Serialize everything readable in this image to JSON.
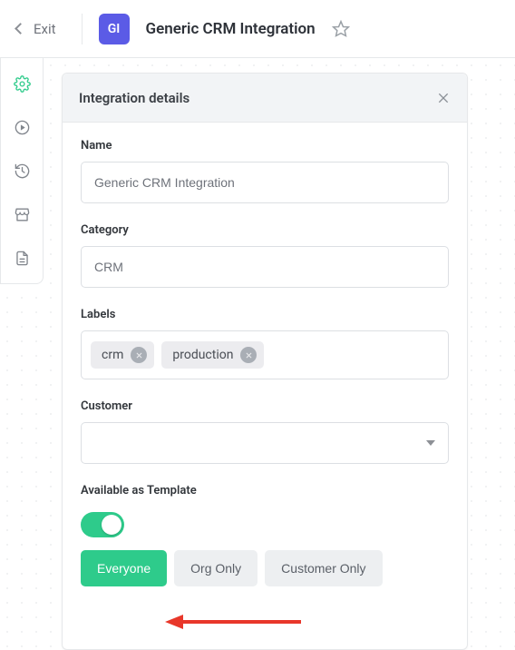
{
  "header": {
    "exit_label": "Exit",
    "badge_text": "GI",
    "title": "Generic CRM Integration"
  },
  "panel": {
    "title": "Integration details",
    "name": {
      "label": "Name",
      "value": "Generic CRM Integration"
    },
    "category": {
      "label": "Category",
      "value": "CRM"
    },
    "labels": {
      "label": "Labels",
      "tags": [
        "crm",
        "production"
      ]
    },
    "customer": {
      "label": "Customer",
      "value": ""
    },
    "template": {
      "label": "Available as Template",
      "enabled": true,
      "options": [
        {
          "label": "Everyone",
          "active": true
        },
        {
          "label": "Org Only",
          "active": false
        },
        {
          "label": "Customer Only",
          "active": false
        }
      ]
    }
  },
  "sidebar_icons": [
    "gear-icon",
    "play-circle-icon",
    "history-icon",
    "storefront-icon",
    "file-text-icon"
  ]
}
